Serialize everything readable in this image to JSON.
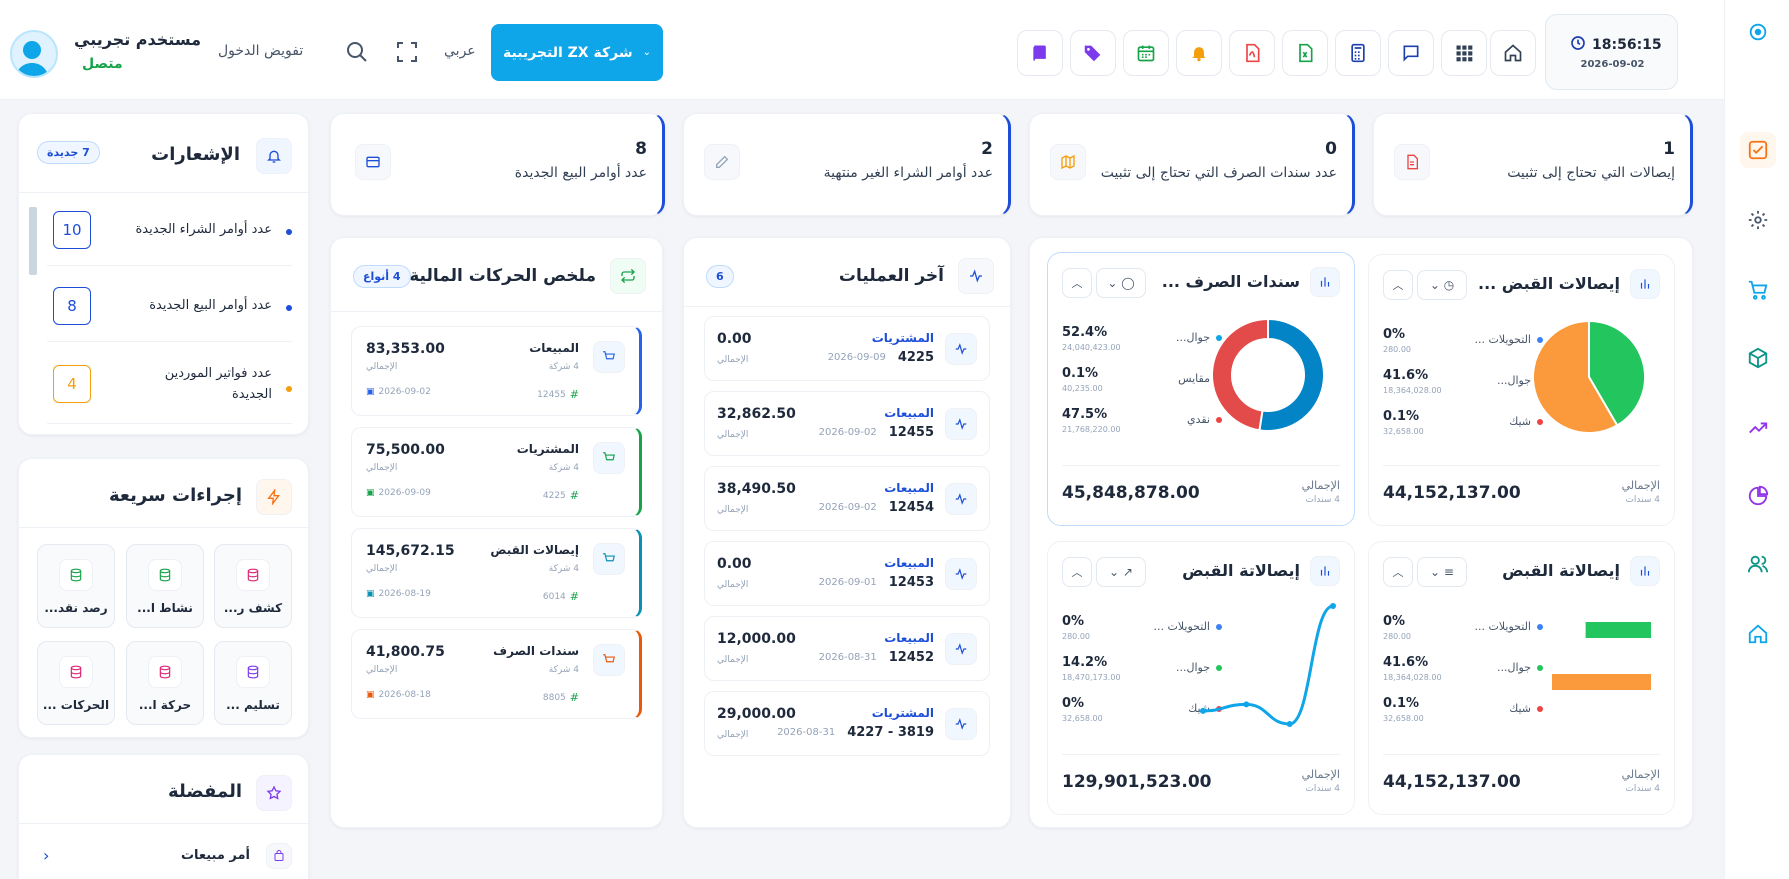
{
  "user": {
    "name": "مستخدم تجريبي",
    "status": "متصل"
  },
  "header": {
    "delegate_login": "تفويض الدخول",
    "language": "عربي",
    "company": "شركة ZX التجريبية",
    "time": "18:56:15",
    "date": "2026-09-02"
  },
  "stats": [
    {
      "value": "1",
      "label": "إيصالات التي تحتاج إلى تثبيت"
    },
    {
      "value": "0",
      "label": "عدد سندات الصرف التي تحتاج إلى تثبيت"
    },
    {
      "value": "2",
      "label": "عدد أوامر الشراء الغير منتهية"
    },
    {
      "value": "8",
      "label": "عدد أوامر البيع الجديدة"
    }
  ],
  "notifications": {
    "title": "الإشعارات",
    "badge": "7 جديدة",
    "items": [
      {
        "label": "عدد أوامر الشراء الجديدة",
        "count": "10"
      },
      {
        "label": "عدد أوامر البيع الجديدة",
        "count": "8"
      },
      {
        "label": "عدد فواتير الموردين الجديدة",
        "count": "4"
      }
    ]
  },
  "quick_actions": {
    "title": "إجراءات سريعة",
    "items": [
      "رصد نقد...",
      "نشاط ا...",
      "كشف ر...",
      "الحركات ...",
      "حركة ا...",
      "تسليم ..."
    ]
  },
  "favorites": {
    "title": "المفضلة",
    "items": [
      "أمر مبيعات"
    ]
  },
  "financial": {
    "title": "ملخص الحركات المالية",
    "badge": "4 أنواع",
    "items": [
      {
        "type": "المبيعات",
        "sub": "4 شركة",
        "amount": "83,353.00",
        "total_label": "الإجمالي",
        "date": "2026-09-02",
        "ref": "12455",
        "color": "#2563eb"
      },
      {
        "type": "المشتريات",
        "sub": "4 شركة",
        "amount": "75,500.00",
        "total_label": "الإجمالي",
        "date": "2026-09-09",
        "ref": "4225",
        "color": "#16a34a"
      },
      {
        "type": "إيصالات القبض",
        "sub": "4 شركة",
        "amount": "145,672.15",
        "total_label": "الإجمالي",
        "date": "2026-08-19",
        "ref": "6014",
        "color": "#0891b2"
      },
      {
        "type": "سندات الصرف",
        "sub": "4 شركة",
        "amount": "41,800.75",
        "total_label": "الإجمالي",
        "date": "2026-08-18",
        "ref": "8805",
        "color": "#ea580c"
      }
    ]
  },
  "operations": {
    "title": "آخر العمليات",
    "badge": "6",
    "items": [
      {
        "type": "المشتريات",
        "ref": "4225",
        "date": "2026-09-09",
        "amount": "0.00",
        "total_label": "الإجمالي"
      },
      {
        "type": "المبيعات",
        "ref": "12455",
        "date": "2026-09-02",
        "amount": "32,862.50",
        "total_label": "الإجمالي"
      },
      {
        "type": "المبيعات",
        "ref": "12454",
        "date": "2026-09-02",
        "amount": "38,490.50",
        "total_label": "الإجمالي"
      },
      {
        "type": "المبيعات",
        "ref": "12453",
        "date": "2026-09-01",
        "amount": "0.00",
        "total_label": "الإجمالي"
      },
      {
        "type": "المبيعات",
        "ref": "12452",
        "date": "2026-08-31",
        "amount": "12,000.00",
        "total_label": "الإجمالي"
      },
      {
        "type": "المشتريات",
        "ref": "4227 - 3819",
        "date": "2026-08-31",
        "amount": "29,000.00",
        "total_label": "الإجمالي"
      }
    ]
  },
  "widgets": [
    {
      "title": "إيصالات القبض ...",
      "total": "44,152,137.00",
      "total_label": "الإجمالي",
      "total_sub": "4 سندات",
      "legend": [
        {
          "label": "التحويلات ...",
          "pct": "0%",
          "amount": "280.00",
          "color": "#3b82f6"
        },
        {
          "label": "جوال...",
          "pct": "41.6%",
          "amount": "18,364,028.00",
          "color": "#22c55e"
        },
        {
          "label": "شيك",
          "pct": "0.1%",
          "amount": "32,658.00",
          "color": "#ef4444"
        }
      ]
    },
    {
      "title": "سندات الصرف ...",
      "total": "45,848,878.00",
      "total_label": "الإجمالي",
      "total_sub": "4 سندات",
      "legend": [
        {
          "label": "جوال...",
          "pct": "52.4%",
          "amount": "24,040,423.00",
          "color": "#0ea5e9"
        },
        {
          "label": "مقايس",
          "pct": "0.1%",
          "amount": "40,235.00",
          "color": "#22c55e"
        },
        {
          "label": "نقدي",
          "pct": "47.5%",
          "amount": "21,768,220.00",
          "color": "#ef4444"
        }
      ]
    },
    {
      "title": "إيصالاتة القبض",
      "total": "44,152,137.00",
      "total_label": "الإجمالي",
      "total_sub": "4 سندات",
      "legend": [
        {
          "label": "التحويلات ...",
          "pct": "0%",
          "amount": "280.00",
          "color": "#3b82f6"
        },
        {
          "label": "جوال...",
          "pct": "41.6%",
          "amount": "18,364,028.00",
          "color": "#22c55e"
        },
        {
          "label": "شيك",
          "pct": "0.1%",
          "amount": "32,658.00",
          "color": "#ef4444"
        }
      ]
    },
    {
      "title": "إيصالاتة القبض",
      "total": "129,901,523.00",
      "total_label": "الإجمالي",
      "total_sub": "4 سندات",
      "legend": [
        {
          "label": "التحويلات ...",
          "pct": "0%",
          "amount": "280.00",
          "color": "#3b82f6"
        },
        {
          "label": "جوال...",
          "pct": "14.2%",
          "amount": "18,470,173.00",
          "color": "#22c55e"
        },
        {
          "label": "شيك",
          "pct": "0%",
          "amount": "32,658.00",
          "color": "#ef4444"
        }
      ]
    }
  ],
  "chart_data": [
    {
      "type": "pie",
      "labels": [
        "جوال...",
        "",
        ""
      ],
      "values": [
        41.6,
        58.4
      ],
      "colors": [
        "#22c55e",
        "#fb9a3c"
      ]
    },
    {
      "type": "pie",
      "donut": true,
      "labels": [
        "جوال...",
        "نقدي"
      ],
      "values": [
        52.4,
        47.5
      ],
      "colors": [
        "#0284c7",
        "#e34a4a"
      ]
    },
    {
      "type": "bar",
      "orientation": "horizontal",
      "categories": [
        "جوال...",
        "شيك"
      ],
      "values": [
        41.6,
        63
      ],
      "colors": [
        "#22c55e",
        "#fb9a3c"
      ]
    },
    {
      "type": "line",
      "x": [
        1,
        2,
        3,
        4
      ],
      "y": [
        2,
        3,
        0,
        18
      ]
    }
  ]
}
